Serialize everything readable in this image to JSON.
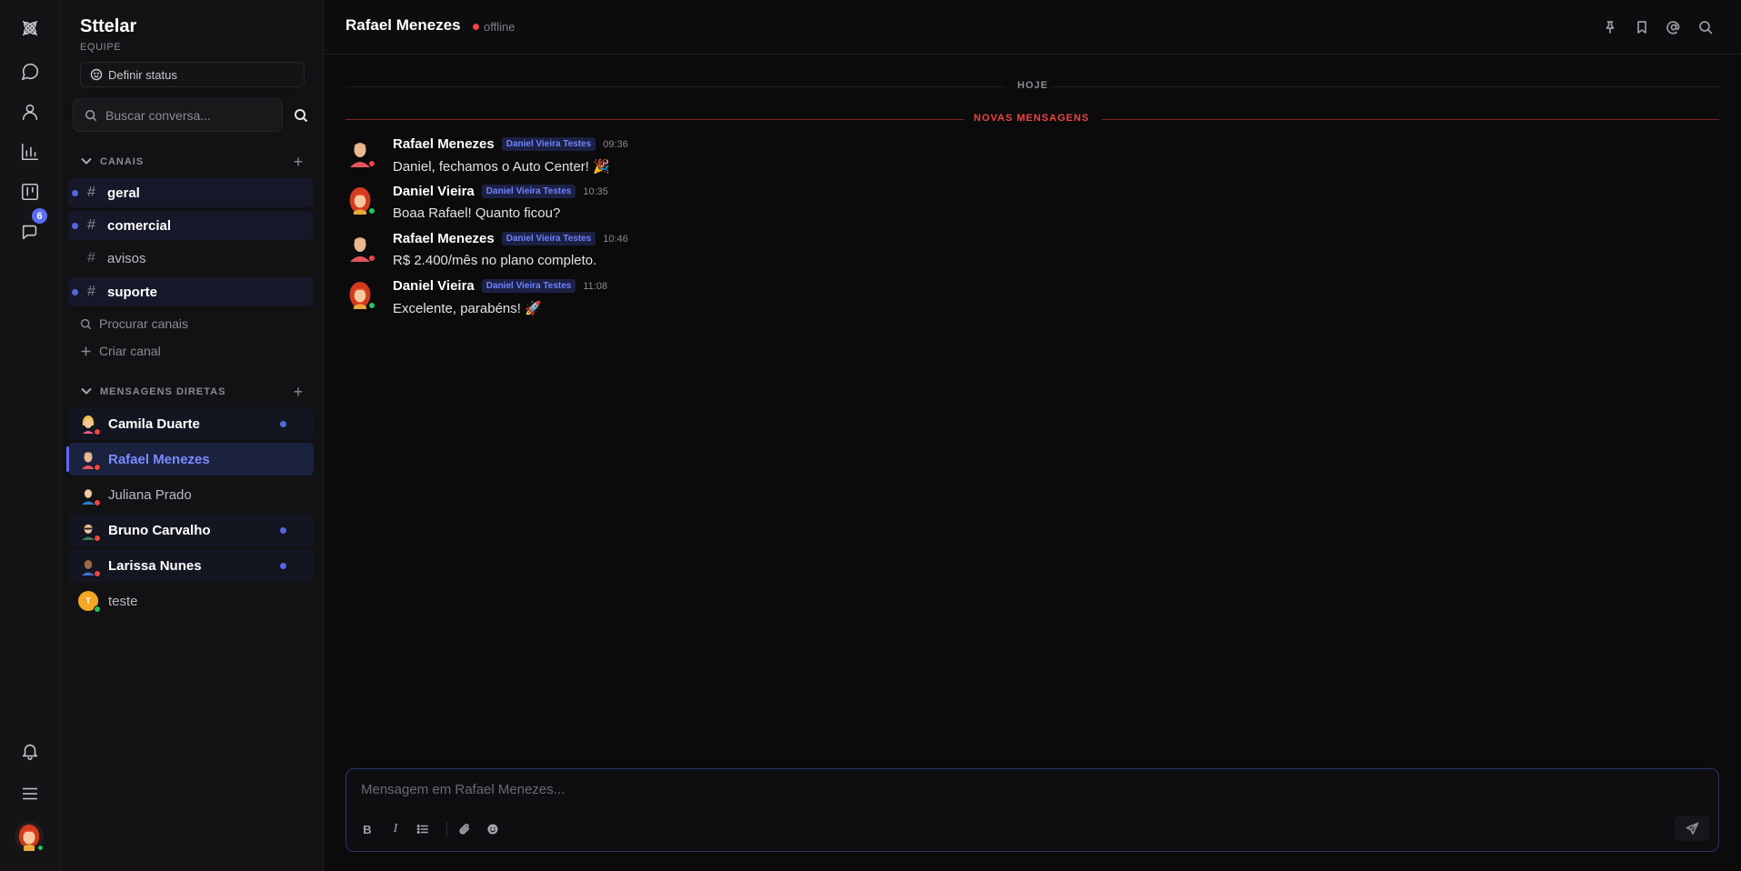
{
  "rail": {
    "items": [
      {
        "icon": "messages-icon"
      },
      {
        "icon": "contacts-icon"
      },
      {
        "icon": "reports-icon"
      },
      {
        "icon": "kanban-icon"
      },
      {
        "icon": "team-chat-icon",
        "badge": "6"
      }
    ],
    "bottom": [
      {
        "icon": "bell-icon"
      },
      {
        "icon": "menu-icon"
      }
    ]
  },
  "sidebar": {
    "workspace": "Sttelar",
    "workspace_sub": "EQUIPE",
    "status_button": "Definir status",
    "search_placeholder": "Buscar conversa...",
    "channels_header": "CANAIS",
    "channels": [
      {
        "name": "geral",
        "unread": true
      },
      {
        "name": "comercial",
        "unread": true
      },
      {
        "name": "avisos",
        "unread": false
      },
      {
        "name": "suporte",
        "unread": true
      }
    ],
    "hash": "#",
    "browse_channels": "Procurar canais",
    "create_channel": "Criar canal",
    "dms_header": "MENSAGENS DIRETAS",
    "dms": [
      {
        "name": "Camila Duarte",
        "unread": true,
        "status": "offline"
      },
      {
        "name": "Rafael Menezes",
        "active": true,
        "status": "offline"
      },
      {
        "name": "Juliana Prado",
        "unread": false,
        "status": "offline"
      },
      {
        "name": "Bruno Carvalho",
        "unread": true,
        "status": "offline"
      },
      {
        "name": "Larissa Nunes",
        "unread": true,
        "status": "offline"
      },
      {
        "name": "teste",
        "unread": false,
        "status": "online",
        "initial": "T"
      }
    ]
  },
  "chat": {
    "title": "Rafael Menezes",
    "status": "offline",
    "day_divider": "HOJE",
    "new_divider": "NOVAS MENSAGENS",
    "messages": [
      {
        "author": "Rafael Menezes",
        "tag": "Daniel Vieira Testes",
        "time": "09:36",
        "text": "Daniel, fechamos o Auto Center! 🎉",
        "status": "offline"
      },
      {
        "author": "Daniel Vieira",
        "tag": "Daniel Vieira Testes",
        "time": "10:35",
        "text": "Boaa Rafael! Quanto ficou?",
        "status": "online"
      },
      {
        "author": "Rafael Menezes",
        "tag": "Daniel Vieira Testes",
        "time": "10:46",
        "text": "R$ 2.400/mês no plano completo.",
        "status": "offline"
      },
      {
        "author": "Daniel Vieira",
        "tag": "Daniel Vieira Testes",
        "time": "11:08",
        "text": "Excelente, parabéns! 🚀",
        "status": "online"
      }
    ],
    "composer_placeholder": "Mensagem em Rafael Menezes...",
    "composer_bold": "B",
    "composer_italic": "I"
  },
  "colors": {
    "accent": "#5b6cf0",
    "offline": "#ef4444",
    "online": "#22c55e",
    "new_messages": "#ef4444"
  }
}
